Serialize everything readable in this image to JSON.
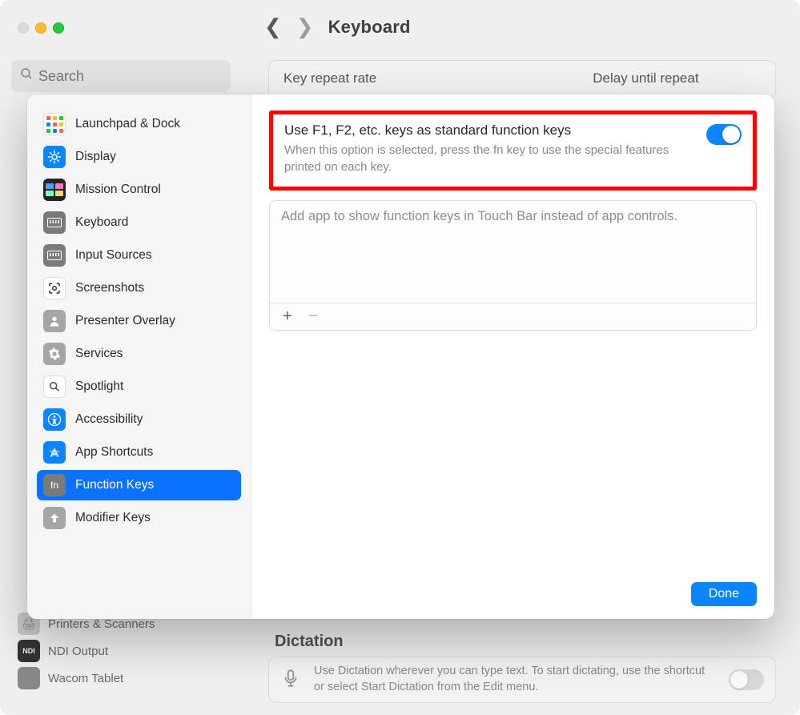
{
  "header": {
    "title": "Keyboard"
  },
  "search": {
    "placeholder": "Search"
  },
  "bg_panel": {
    "col1": "Key repeat rate",
    "col2": "Delay until repeat"
  },
  "bg_sidebar_bottom": [
    "Printers & Scanners",
    "NDI Output",
    "Wacom Tablet"
  ],
  "dictation": {
    "title": "Dictation",
    "text": "Use Dictation wherever you can type text. To start dictating, use the shortcut or select Start Dictation from the Edit menu."
  },
  "modal_sidebar": {
    "items": [
      {
        "label": "Launchpad & Dock",
        "icon": "launchpad"
      },
      {
        "label": "Display",
        "icon": "display"
      },
      {
        "label": "Mission Control",
        "icon": "mission"
      },
      {
        "label": "Keyboard",
        "icon": "keyboard"
      },
      {
        "label": "Input Sources",
        "icon": "input"
      },
      {
        "label": "Screenshots",
        "icon": "screenshot"
      },
      {
        "label": "Presenter Overlay",
        "icon": "presenter"
      },
      {
        "label": "Services",
        "icon": "services"
      },
      {
        "label": "Spotlight",
        "icon": "spotlight"
      },
      {
        "label": "Accessibility",
        "icon": "access"
      },
      {
        "label": "App Shortcuts",
        "icon": "appshort"
      },
      {
        "label": "Function Keys",
        "icon": "fn",
        "selected": true
      },
      {
        "label": "Modifier Keys",
        "icon": "modifier"
      }
    ]
  },
  "fn_panel": {
    "title": "Use F1, F2, etc. keys as standard function keys",
    "desc": "When this option is selected, press the fn key to use the special features printed on each key.",
    "toggle_on": true
  },
  "apps_panel": {
    "placeholder": "Add app to show function keys in Touch Bar instead of app controls.",
    "plus": "+",
    "minus": "−"
  },
  "done_label": "Done"
}
